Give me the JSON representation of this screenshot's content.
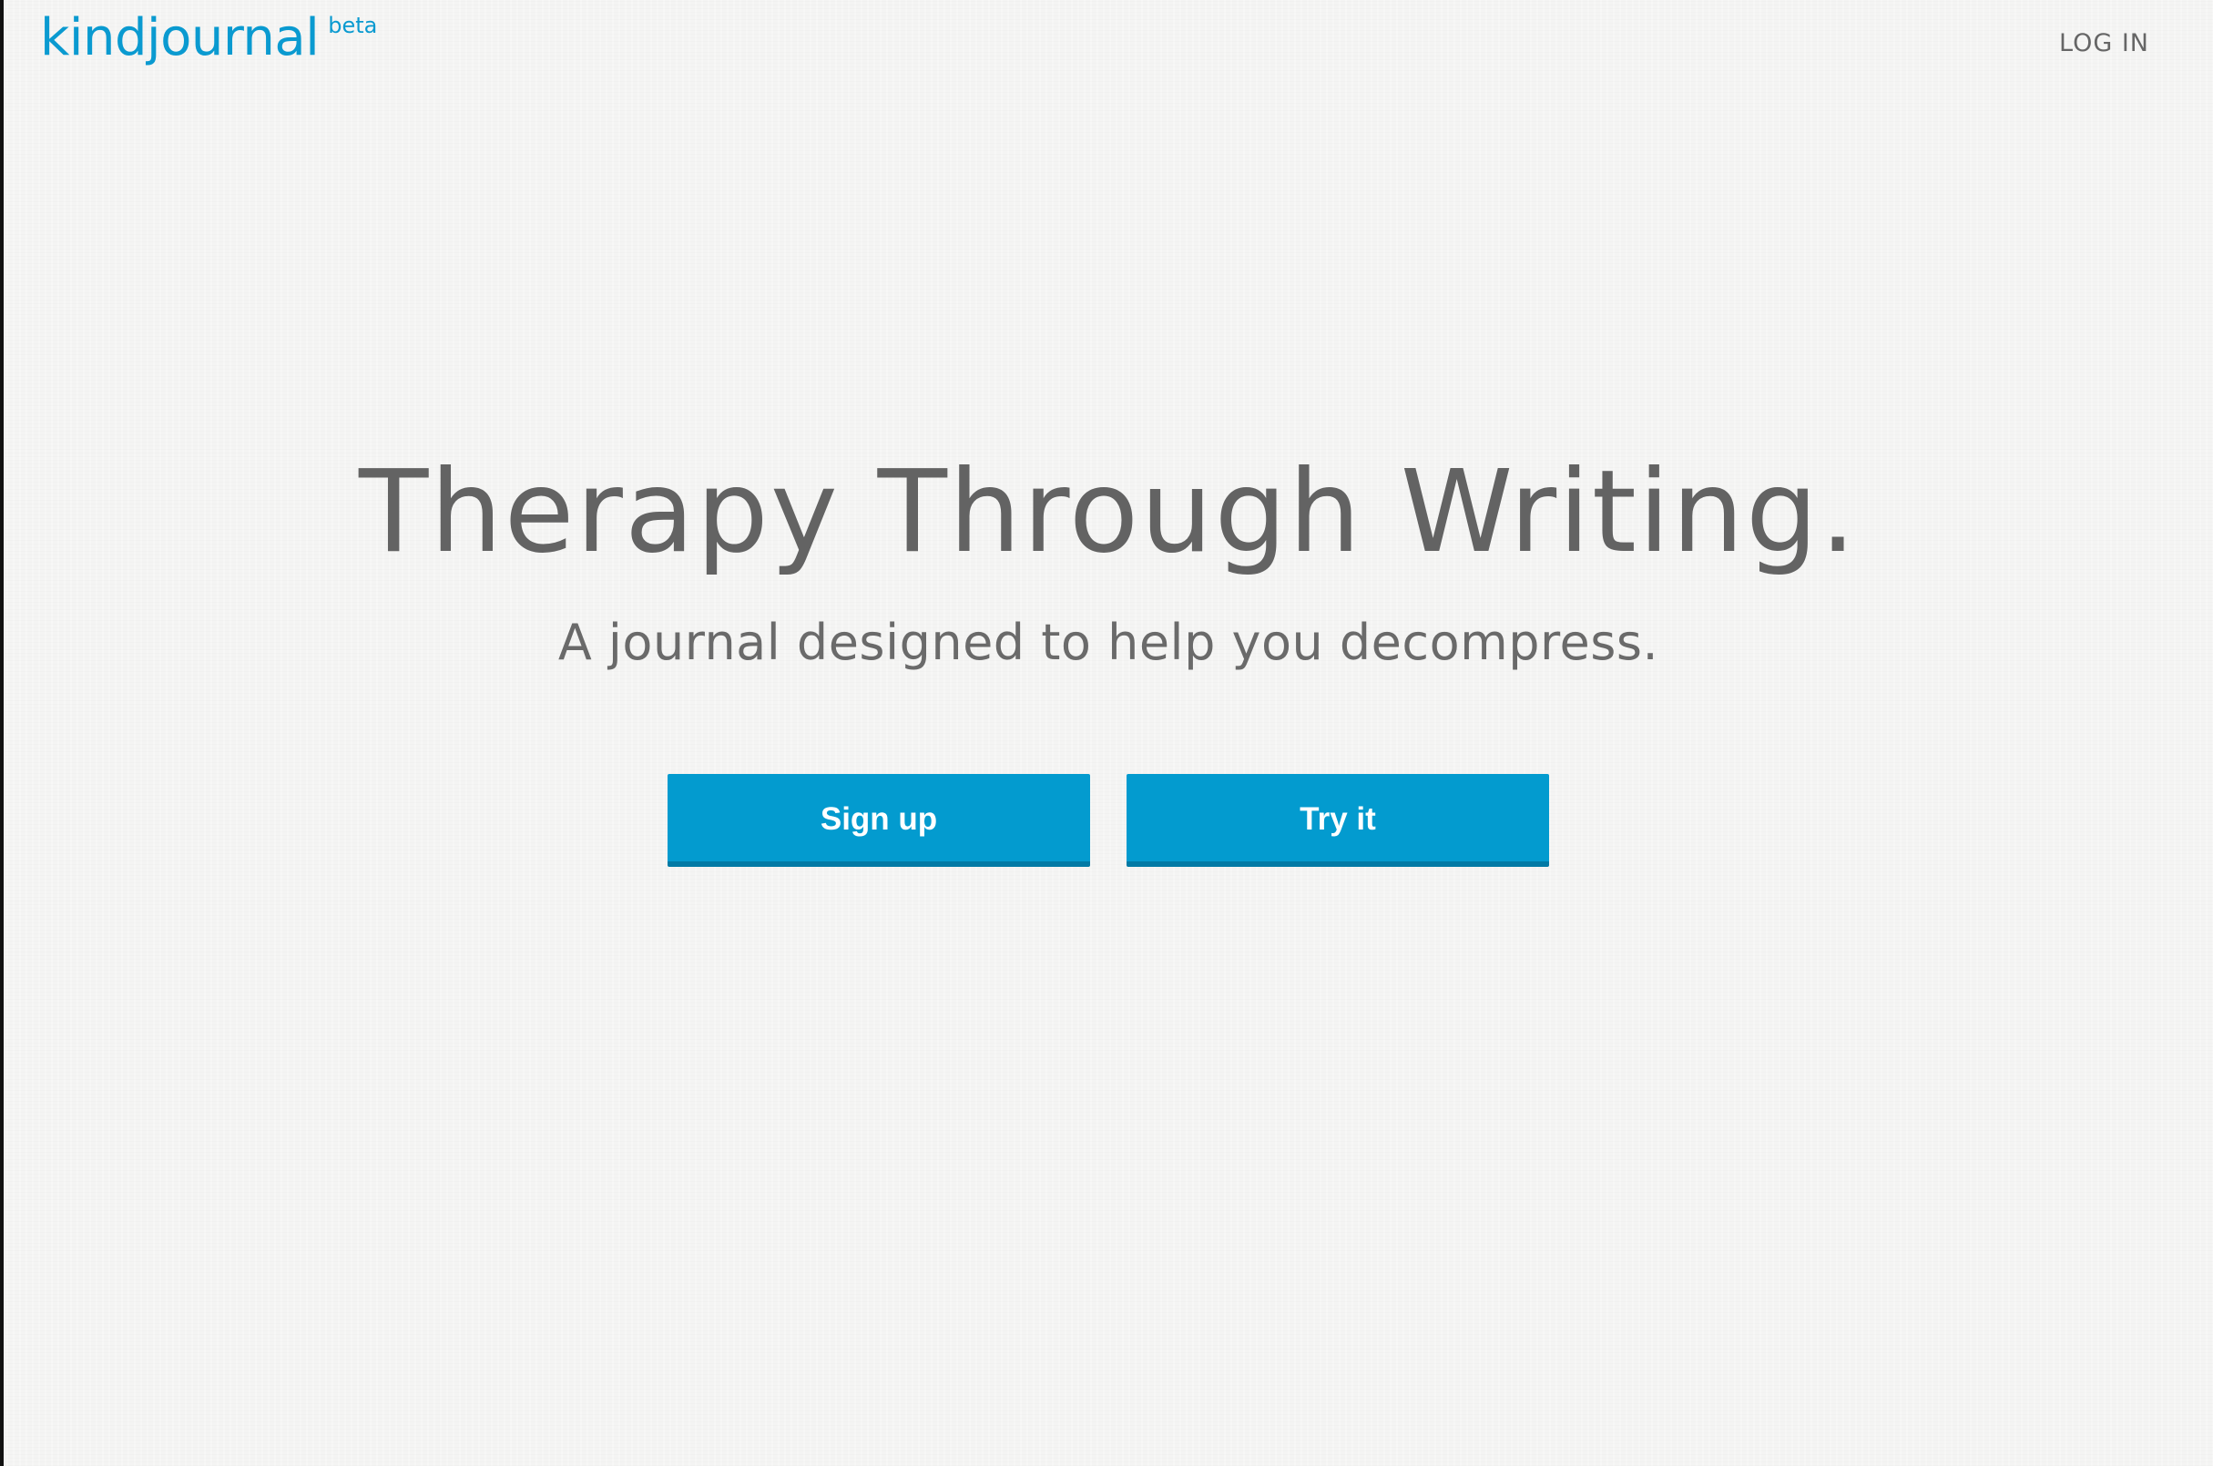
{
  "header": {
    "logo_text": "kindjournal",
    "logo_badge": "beta",
    "login_label": "LOG IN"
  },
  "hero": {
    "headline": "Therapy Through Writing.",
    "subheadline": "A journal designed to help you decompress."
  },
  "actions": {
    "signup_label": "Sign up",
    "try_label": "Try it"
  },
  "colors": {
    "brand": "#0a9ad0",
    "button": "#039bcf",
    "button_shadow": "#027aa5",
    "text": "#636363",
    "background": "#f4f4f3"
  }
}
